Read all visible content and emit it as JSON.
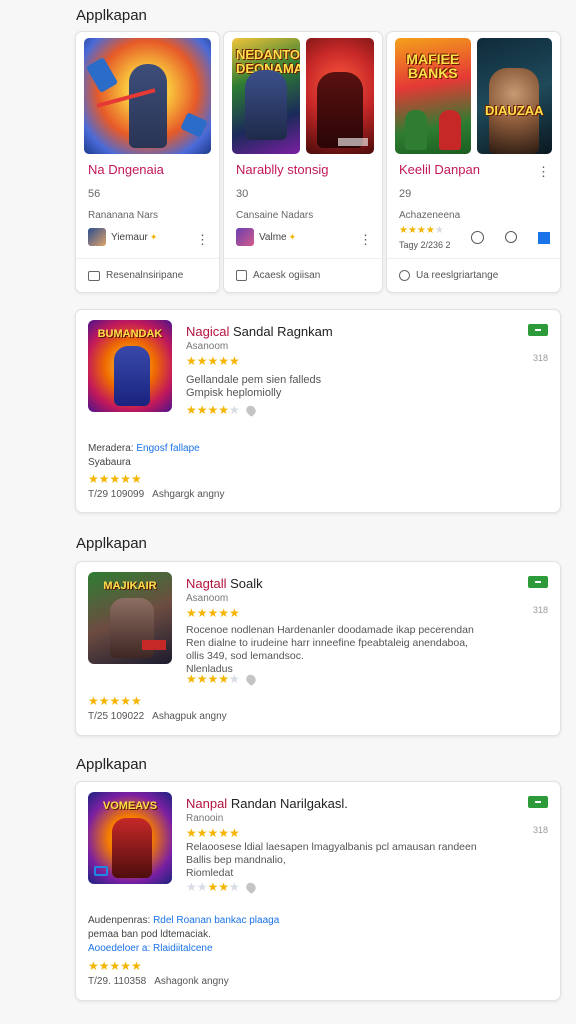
{
  "sections": [
    {
      "title": "Applkapan"
    },
    {
      "title": "Applkapan"
    },
    {
      "title": "Applkapan"
    }
  ],
  "top_cards": [
    {
      "thumbs": [
        ""
      ],
      "name": "Na Dngenaia",
      "count": "56",
      "sub": "Rananana Nars",
      "dev": "Yiemaur",
      "footer": "Resenalnsiripane"
    },
    {
      "thumbs": [
        "NEDANTO DEONAMAN",
        ""
      ],
      "name": "Narablly stonsig",
      "count": "30",
      "sub": "Cansaine Nadars",
      "dev": "Valme",
      "footer": "Acaesk ogiisan"
    },
    {
      "thumbs": [
        "MAFIEE BANKS",
        "DIAUZAA"
      ],
      "name": "Keelil Danpan",
      "count": "29",
      "sub": "Achazeneena",
      "dev_date": "Tagy 2/236 2",
      "footer": "Ua reeslgriartange"
    }
  ],
  "apps": [
    {
      "icon_title": "BUMANDAK",
      "title_red": "Nagical",
      "title_rest": "Sandal Ragnkam",
      "publisher": "Asanoom",
      "desc": [
        "Gellandale pem sien falleds",
        "Gmpisk heplomiolly"
      ],
      "size": "318",
      "meta1_label": "Meradera:",
      "meta1_link": "Engosf fallape",
      "meta2": "Syabaura",
      "date": "T/29 109099",
      "date_note": "Ashgargk angny"
    },
    {
      "icon_title": "MAJIKAIR",
      "title_red": "Nagtall",
      "title_rest": "Soalk",
      "publisher": "Asanoom",
      "desc": [
        "Rocenoe nodlenan Hardenanler doodamade ikap pecerendan",
        "Ren dialne to irudeine harr inneefine fpeabtaleig anendaboa,",
        "ollis 349, sod lemandsoc.",
        "Nlenladus"
      ],
      "size": "318",
      "date": "T/25 109022",
      "date_note": "Ashagpuk angny"
    },
    {
      "icon_title": "VOMEAVS",
      "title_red": "Nanpal",
      "title_rest": "Randan Narilgakasl.",
      "publisher": "Ranooin",
      "desc": [
        "Relaoosese ldial laesapen lmagyalbanis pcl amausan randeen",
        "Ballis bep mandnalio,",
        "Riomledat"
      ],
      "size": "318",
      "meta1_label": "Audenpenras:",
      "meta1_link": "Rdel Roanan bankac plaaga",
      "meta2": "pemaa ban pod ldtemaciak.",
      "meta3": "Aooedeloer a: Rlaidiitalcene",
      "date": "T/29. 110358",
      "date_note": "Ashagonk angny"
    }
  ],
  "colors": {
    "accent_red": "#b3123d",
    "install_green": "#2e9b3a",
    "star": "#f5b400",
    "link": "#1a73e8"
  }
}
